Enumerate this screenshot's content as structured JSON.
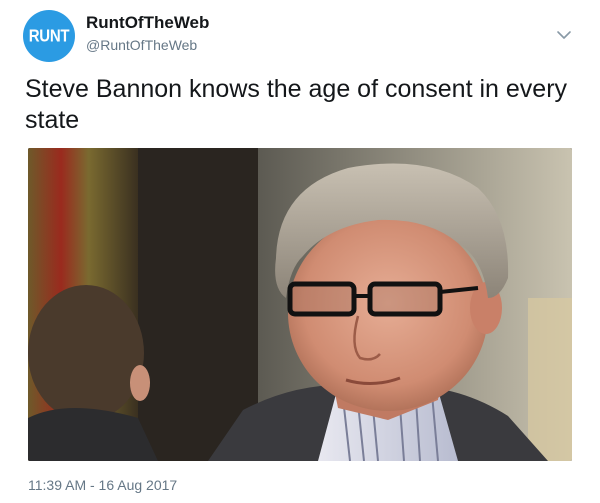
{
  "tweet": {
    "avatar_text": "RUNT",
    "display_name": "RuntOfTheWeb",
    "handle": "@RuntOfTheWeb",
    "text": "Steve Bannon knows the age of consent in every state",
    "timestamp": "11:39 AM - 16 Aug 2017",
    "menu_icon": "chevron-down-icon",
    "avatar_color": "#2b9be3",
    "media_icon": "photo-of-man-in-glasses"
  }
}
